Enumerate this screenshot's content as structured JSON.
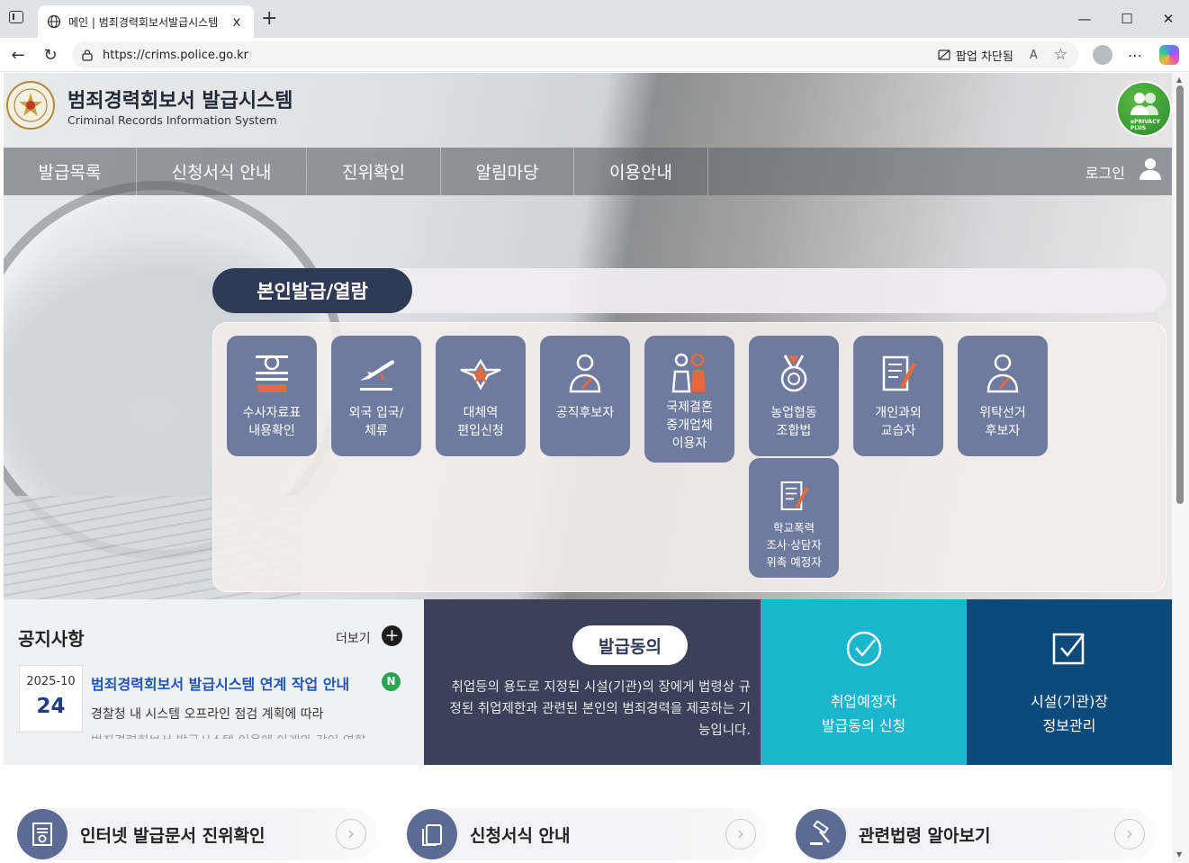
{
  "browser": {
    "tab_title": "메인 | 범죄경력회보서발급시스템",
    "tab_close": "x",
    "url": "https://crims.police.go.kr",
    "popup_blocked": "팝업 차단됨"
  },
  "header": {
    "title": "범죄경력회보서 발급시스템",
    "subtitle": "Criminal Records Information System",
    "badge_text": "ePRIVACY PLUS"
  },
  "nav": {
    "items": [
      "발급목록",
      "신청서식 안내",
      "진위확인",
      "알림마당",
      "이용안내"
    ],
    "login": "로그인"
  },
  "self_issue": {
    "title": "본인발급/열람",
    "services": [
      {
        "label": "수사자료표\n내용확인",
        "icon": "document-lines-icon"
      },
      {
        "label": "외국 입국/\n체류",
        "icon": "airplane-icon"
      },
      {
        "label": "대체역\n편입신청",
        "icon": "military-emblem-icon"
      },
      {
        "label": "공직후보자",
        "icon": "person-pen-icon"
      },
      {
        "label": "국제결혼\n중개업체\n이용자",
        "icon": "couple-icon"
      },
      {
        "label": "농업협동\n조합법",
        "icon": "medal-icon"
      },
      {
        "label": "개인과외\n교습자",
        "icon": "document-pen-icon"
      },
      {
        "label": "위탁선거\n후보자",
        "icon": "person-pen-icon"
      },
      {
        "label": "학교폭력\n조사·상담자\n위촉 예정자",
        "icon": "document-pen-icon"
      }
    ]
  },
  "notice": {
    "title": "공지사항",
    "more": "더보기",
    "date_ym": "2025-10",
    "date_day": "24",
    "headline": "범죄경력회보서 발급시스템 연계 작업 안내",
    "new_badge": "N",
    "body": "경찰청 내 시스템 오프라인 점검 계획에 따라",
    "body_cut": "범죄경력회보서 발급시스템 이용에 아래와 같이 영향"
  },
  "consent": {
    "title": "발급동의",
    "desc": "취업등의 용도로 지정된 시설(기관)의 장에게 법령상 규정된 취업제한과 관련된 본인의 범죄경력을 제공하는 기능입니다."
  },
  "tiles": {
    "apply": "취업예정자\n발급동의 신청",
    "facility": "시설(기관)장\n정보관리"
  },
  "quick_links": [
    {
      "label": "인터넷 발급문서 진위확인",
      "icon": "certificate-icon"
    },
    {
      "label": "신청서식 안내",
      "icon": "files-icon"
    },
    {
      "label": "관련법령 알아보기",
      "icon": "gavel-icon"
    }
  ],
  "colors": {
    "nav_bg": "#5f646c",
    "pill_dark": "#2f3b56",
    "service_tile": "#6e7a9e",
    "consent_bg": "#3a4159",
    "tile_cyan": "#1ab6cd",
    "tile_navy": "#0c4a7b",
    "new_badge": "#2aa552"
  }
}
